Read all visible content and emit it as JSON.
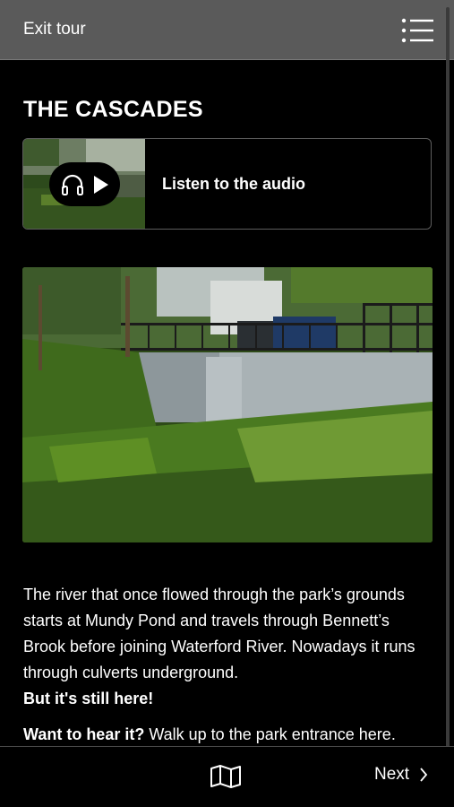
{
  "header": {
    "exit_label": "Exit tour",
    "menu_icon": "list-menu-icon"
  },
  "stop": {
    "title": "THE CASCADES",
    "audio": {
      "label": "Listen to the audio",
      "icons": [
        "headphones-icon",
        "play-icon"
      ]
    },
    "photo_subject": "river-photo",
    "paragraph_1": {
      "text": "The river that once flowed through the park’s grounds starts at Mundy Pond and travels through Bennett’s Brook before joining Waterford River. Nowadays it runs through culverts underground.",
      "emphasis": "But it's still here!"
    },
    "paragraph_2": {
      "emphasis": "Want to hear it?",
      "text": " Walk up to the park entrance here."
    }
  },
  "footer": {
    "map_icon": "map-icon",
    "next_label": "Next"
  },
  "colors": {
    "background": "#000000",
    "header_bar": "#5a5a5a",
    "text": "#ffffff",
    "card_border": "#5d5d5d"
  }
}
